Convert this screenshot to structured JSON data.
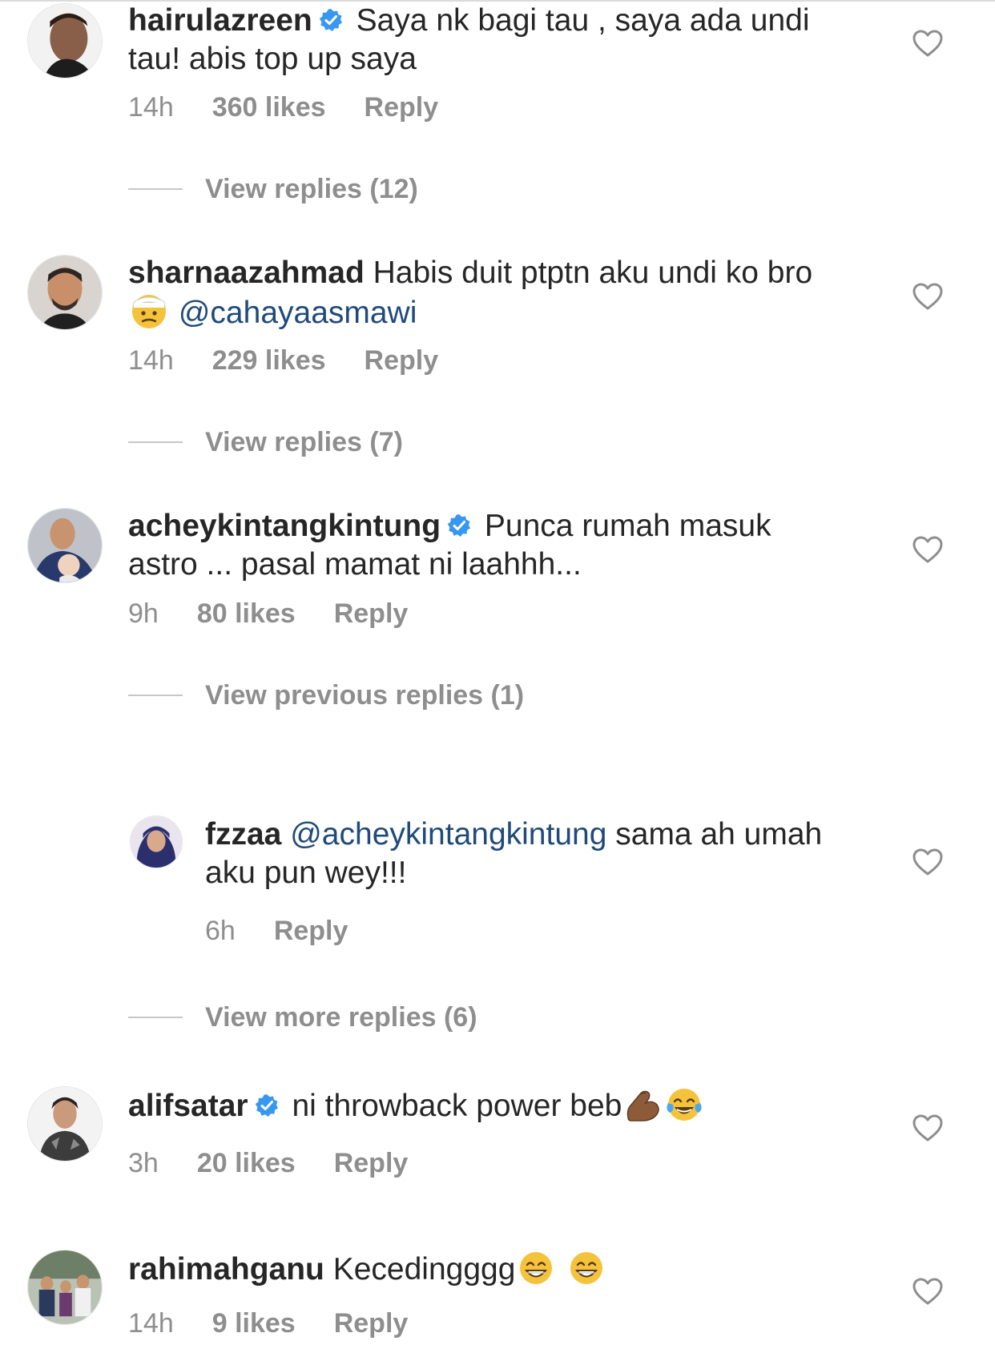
{
  "comments": [
    {
      "username": "hairulazreen",
      "verified": true,
      "text": "Saya nk bagi tau , saya ada undi tau! abis top up saya",
      "time": "14h",
      "likes": "360 likes",
      "reply": "Reply",
      "view_replies": "View replies (12)"
    },
    {
      "username": "sharnaazahmad",
      "verified": false,
      "text_before": "Habis duit ptptn aku undi ko bro",
      "emoji": "head-bandage-emoji",
      "mention": "@cahayaasmawi",
      "time": "14h",
      "likes": "229 likes",
      "reply": "Reply",
      "view_replies": "View replies (7)"
    },
    {
      "username": "acheykintangkintung",
      "verified": true,
      "text": "Punca rumah masuk astro ... pasal mamat ni laahhh...",
      "time": "9h",
      "likes": "80 likes",
      "reply": "Reply",
      "view_previous_replies": "View previous replies (1)",
      "replies": [
        {
          "username": "fzzaa",
          "mention": "@acheykintangkintung",
          "text": "sama ah umah aku pun wey!!!",
          "time": "6h",
          "reply": "Reply"
        }
      ],
      "view_more_replies": "View more replies (6)"
    },
    {
      "username": "alifsatar",
      "verified": true,
      "text": "ni throwback power beb",
      "emojis": [
        "flexed-biceps-emoji",
        "tears-of-joy-emoji"
      ],
      "time": "3h",
      "likes": "20 likes",
      "reply": "Reply"
    },
    {
      "username": "rahimahganu",
      "verified": false,
      "text": "Kecedingggg",
      "emojis": [
        "grinning-emoji",
        "grinning-emoji"
      ],
      "time": "14h",
      "likes": "9 likes",
      "reply": "Reply"
    }
  ],
  "colors": {
    "text": "#262626",
    "meta": "#8e8e8e",
    "mention": "#1f4a7a",
    "verified": "#3897f0"
  }
}
